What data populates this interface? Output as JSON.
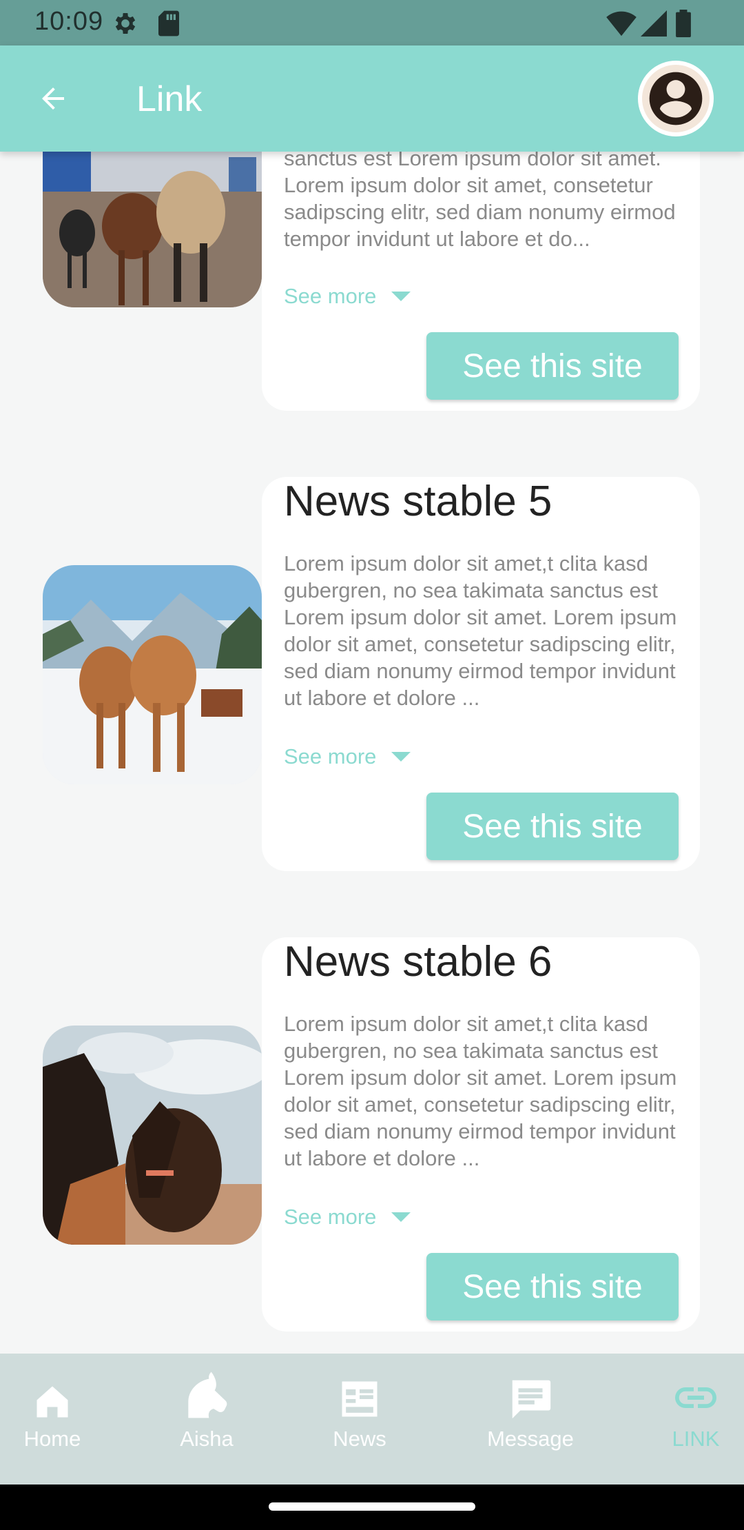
{
  "status_bar": {
    "time": "10:09"
  },
  "app_bar": {
    "title": "Link"
  },
  "cards": [
    {
      "title": "",
      "description": "sanctus est Lorem ipsum dolor sit amet. Lorem ipsum dolor sit amet, consetetur sadipscing elitr, sed diam nonumy eirmod tempor invidunt ut labore et do...",
      "see_more": "See more",
      "button": "See this site"
    },
    {
      "title": "News stable 5",
      "description": "Lorem ipsum dolor sit amet,t clita kasd gubergren, no sea takimata sanctus est Lorem ipsum dolor sit amet. Lorem ipsum dolor sit amet, consetetur sadipscing elitr, sed diam nonumy eirmod tempor invidunt ut labore et dolore ...",
      "see_more": "See more",
      "button": "See this site"
    },
    {
      "title": "News stable 6",
      "description": "Lorem ipsum dolor sit amet,t clita kasd gubergren, no sea takimata sanctus est Lorem ipsum dolor sit amet. Lorem ipsum dolor sit amet, consetetur sadipscing elitr, sed diam nonumy eirmod tempor invidunt ut labore et dolore ...",
      "see_more": "See more",
      "button": "See this site"
    }
  ],
  "bottom_nav": {
    "items": [
      {
        "label": "Home",
        "icon": "home-icon"
      },
      {
        "label": "Aisha",
        "icon": "horse-head-icon"
      },
      {
        "label": "News",
        "icon": "news-icon"
      },
      {
        "label": "Message",
        "icon": "message-icon"
      },
      {
        "label": "LINK",
        "icon": "link-icon"
      }
    ],
    "active_index": 4
  },
  "colors": {
    "accent": "#8bdad0",
    "status_bar": "#669e97",
    "nav_background": "#cfdcdb"
  }
}
